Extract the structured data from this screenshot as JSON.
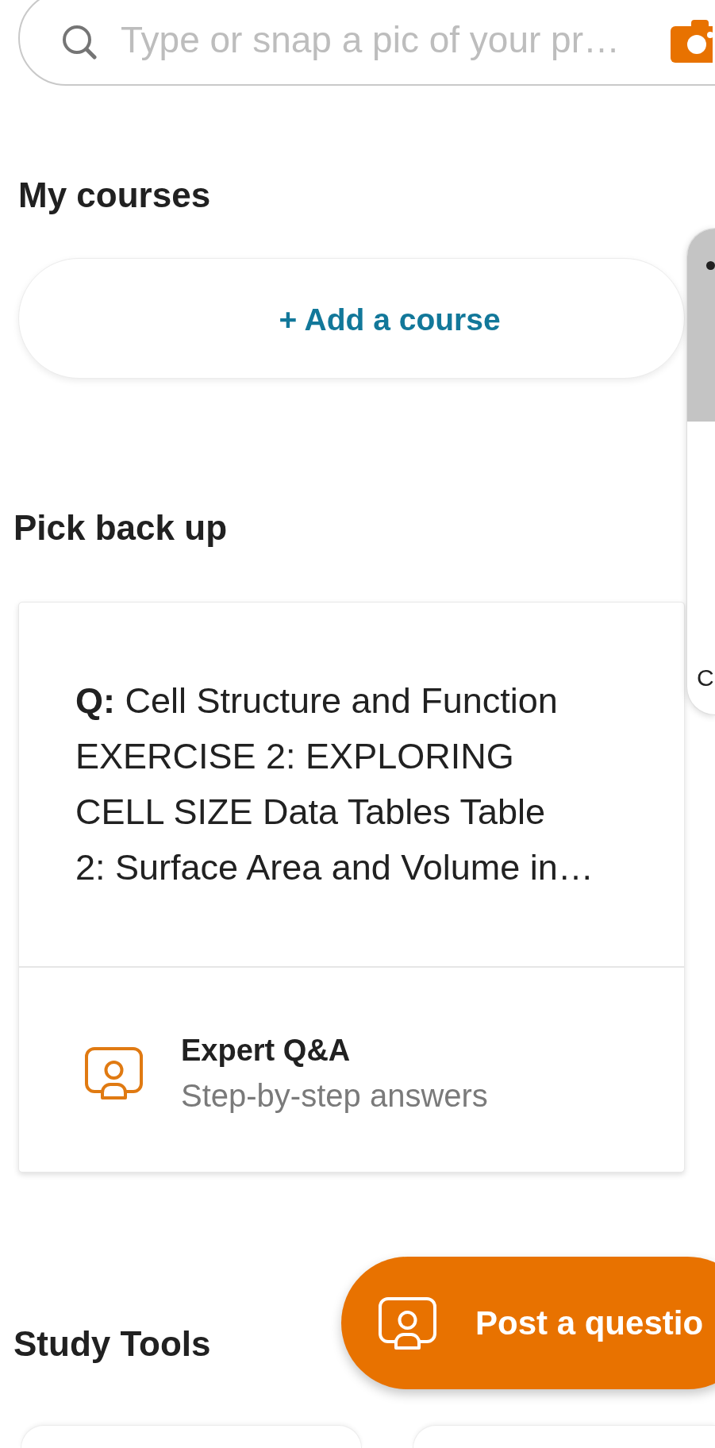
{
  "search": {
    "placeholder": "Type or snap a pic of your pr…"
  },
  "my_courses": {
    "title": "My courses",
    "add_button": "+ Add a course"
  },
  "side_panel": {
    "label": "C"
  },
  "pick_back_up": {
    "title": "Pick back up",
    "cards": [
      {
        "question": "**Q:** Cell Structure and Function\nEXERCISE 2: EXPLORING\nCELL SIZE Data Tables Table\n2: Surface Area and Volume in…",
        "category": "Expert Q&A",
        "subtitle": "Step-by-step answers"
      }
    ]
  },
  "study_tools": {
    "title": "Study Tools"
  },
  "fab": {
    "label": "Post a questio"
  }
}
